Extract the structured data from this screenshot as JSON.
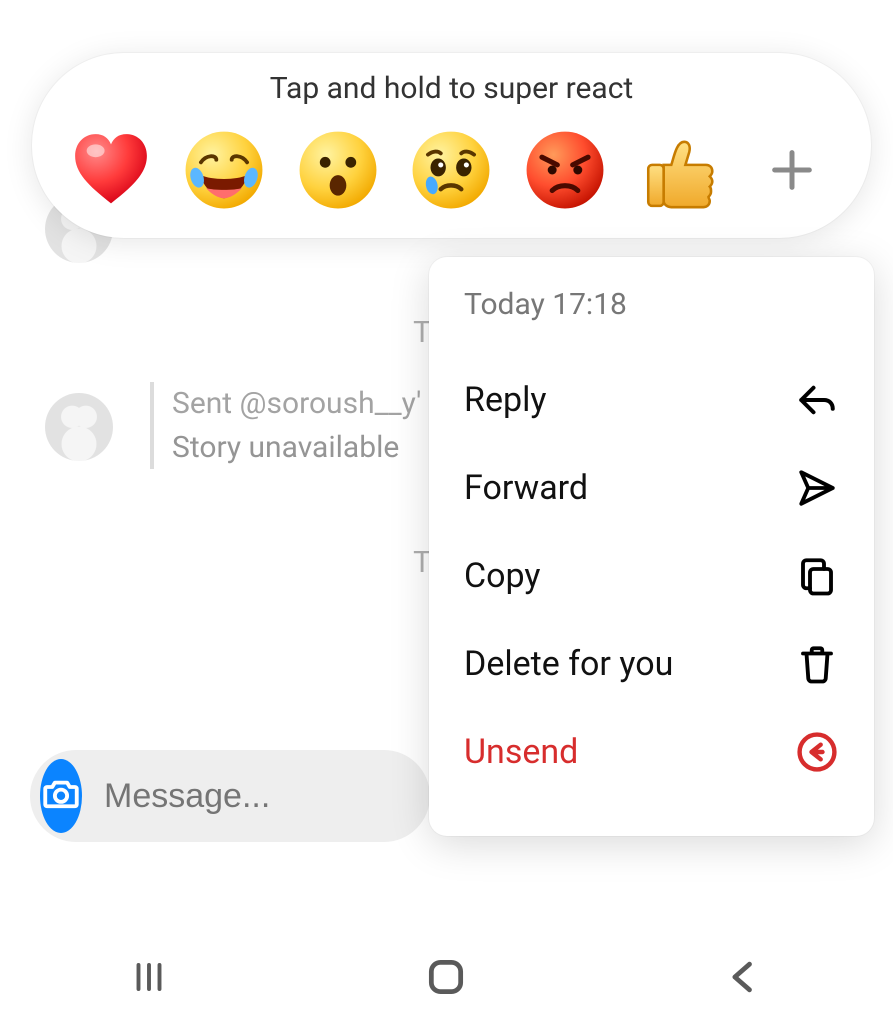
{
  "reaction_bar": {
    "hint": "Tap and hold to super react",
    "emojis": [
      {
        "name": "heart"
      },
      {
        "name": "joy"
      },
      {
        "name": "open-mouth"
      },
      {
        "name": "pleading-cry"
      },
      {
        "name": "angry"
      },
      {
        "name": "thumbs-up"
      }
    ]
  },
  "chat": {
    "timestamps_bg": [
      "Toda",
      "Toda"
    ],
    "story_sent_line1": "Sent @soroush__y'",
    "story_sent_line2": "Story unavailable"
  },
  "context_menu": {
    "timestamp": "Today 17:18",
    "items": [
      {
        "key": "reply",
        "label": "Reply"
      },
      {
        "key": "forward",
        "label": "Forward"
      },
      {
        "key": "copy",
        "label": "Copy"
      },
      {
        "key": "delete_for_you",
        "label": "Delete for you"
      },
      {
        "key": "unsend",
        "label": "Unsend"
      }
    ]
  },
  "input": {
    "placeholder": "Message..."
  },
  "colors": {
    "accent_blue": "#0b84ff",
    "danger": "#d72d2d"
  }
}
